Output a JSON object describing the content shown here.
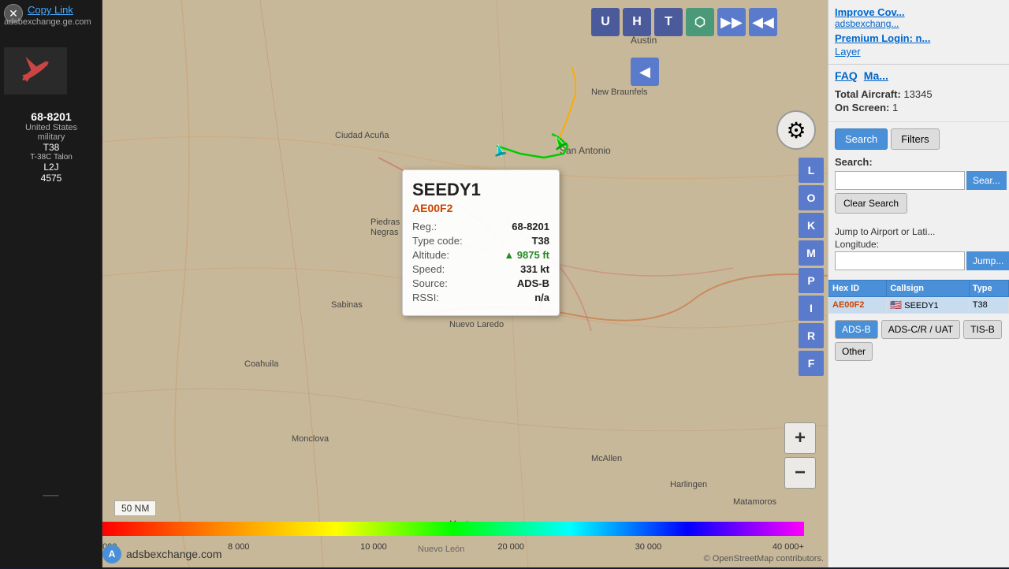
{
  "app": {
    "title": "ADS-B Exchange"
  },
  "left_sidebar": {
    "copy_link_label": "Copy Link",
    "url": "adsbexchange.ge.com",
    "aircraft_reg": "68-8201",
    "aircraft_country": "United States",
    "aircraft_service": "military",
    "aircraft_type": "T38",
    "aircraft_type_full": "T-38C Talon",
    "aircraft_squawk": "L2J",
    "aircraft_num": "4575"
  },
  "map_toolbar": {
    "btn_u": "U",
    "btn_h": "H",
    "btn_t": "T",
    "btn_layers": "⬡",
    "btn_forward": "▶▶",
    "btn_back": "◀◀",
    "btn_left": "◀"
  },
  "side_buttons": {
    "items": [
      "L",
      "O",
      "K",
      "M",
      "P",
      "I",
      "R",
      "F"
    ]
  },
  "aircraft_popup": {
    "callsign": "SEEDY1",
    "hex_id": "AE00F2",
    "reg_label": "Reg.:",
    "reg_value": "68-8201",
    "type_label": "Type code:",
    "type_value": "T38",
    "altitude_label": "Altitude:",
    "altitude_value": "▲ 9875 ft",
    "speed_label": "Speed:",
    "speed_value": "331 kt",
    "source_label": "Source:",
    "source_value": "ADS-B",
    "rssi_label": "RSSI:",
    "rssi_value": "n/a"
  },
  "right_sidebar": {
    "improve_link": "Improve Cov...",
    "improve_full": "adsbexchang...",
    "premium_login": "Premium Login: n...",
    "layer_link": "Layer",
    "faq_link": "FAQ",
    "map_link": "Ma...",
    "total_aircraft_label": "Total Aircraft:",
    "total_aircraft_value": "13345",
    "on_screen_label": "On Screen:",
    "on_screen_value": "1",
    "tab_search": "Search",
    "tab_filters": "Filters",
    "search_label": "Search:",
    "search_placeholder": "",
    "search_btn": "Sear...",
    "clear_search_btn": "Clear Search",
    "jump_label": "Jump to Airport or Lati...",
    "longitude_label": "Longitude:",
    "jump_placeholder": "",
    "jump_btn": "Jump...",
    "table": {
      "col_hex": "Hex ID",
      "col_callsign": "Callsign",
      "col_type": "Type",
      "rows": [
        {
          "hex": "AE00F2",
          "flag": "🇺🇸",
          "callsign": "SEEDY1",
          "type": "T38"
        }
      ]
    },
    "source_buttons": [
      "ADS-B",
      "ADS-C/R / UAT",
      "TIS-B",
      "Other"
    ]
  },
  "map": {
    "cities": [
      "Austin",
      "New Braunfels",
      "San Antonio",
      "Ciudad Acuña",
      "Piedras Negras",
      "Sabinas",
      "Coahuila",
      "Nuevo Laredo",
      "Monclova",
      "McAllen",
      "Harlingen",
      "Matamoros",
      "Monterrey"
    ],
    "scale": "50 NM",
    "color_bar_labels": [
      "000",
      "8 000",
      "10 000",
      "20 000",
      "30 000",
      "40 000+"
    ]
  },
  "copyright": "© OpenStreetMap contributors.",
  "adsb_logo_text": "adsbexchange.com"
}
